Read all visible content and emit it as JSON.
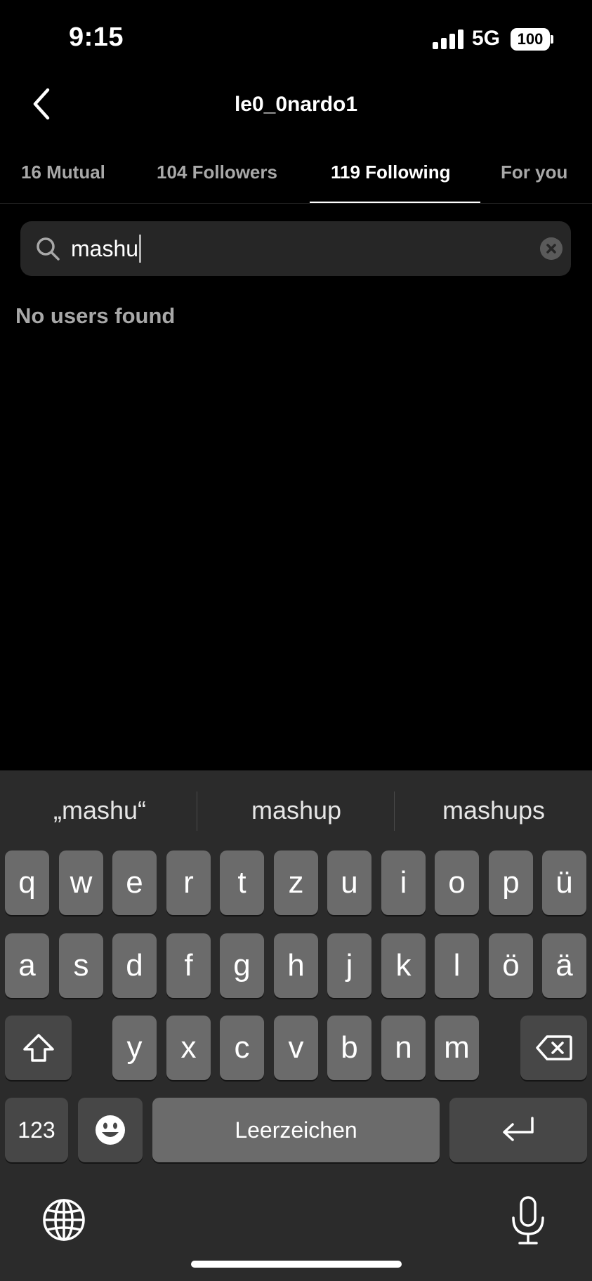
{
  "status_bar": {
    "time": "9:15",
    "network": "5G",
    "battery": "100"
  },
  "header": {
    "title": "le0_0nardo1",
    "back_icon": "chevron-left-icon"
  },
  "tabs": [
    {
      "label": "16 Mutual",
      "active": false
    },
    {
      "label": "104 Followers",
      "active": false
    },
    {
      "label": "119 Following",
      "active": true
    },
    {
      "label": "For you",
      "active": false
    }
  ],
  "search": {
    "value": "mashu",
    "icon": "search-icon",
    "clear_icon": "clear-icon"
  },
  "results": {
    "empty_text": "No users found"
  },
  "keyboard": {
    "suggestions": [
      "„mashu“",
      "mashup",
      "mashups"
    ],
    "row1": [
      "q",
      "w",
      "e",
      "r",
      "t",
      "z",
      "u",
      "i",
      "o",
      "p",
      "ü"
    ],
    "row2": [
      "a",
      "s",
      "d",
      "f",
      "g",
      "h",
      "j",
      "k",
      "l",
      "ö",
      "ä"
    ],
    "row3": [
      "y",
      "x",
      "c",
      "v",
      "b",
      "n",
      "m"
    ],
    "numbers_label": "123",
    "space_label": "Leerzeichen",
    "icons": [
      "shift-icon",
      "backspace-icon",
      "emoji-icon",
      "return-icon",
      "globe-icon",
      "microphone-icon"
    ]
  },
  "colors": {
    "background": "#000000",
    "search_bg": "#262626",
    "keyboard_bg": "#2b2b2b",
    "key": "#6b6b6b",
    "key_dark": "#474747",
    "muted_text": "#a8a8a8"
  }
}
